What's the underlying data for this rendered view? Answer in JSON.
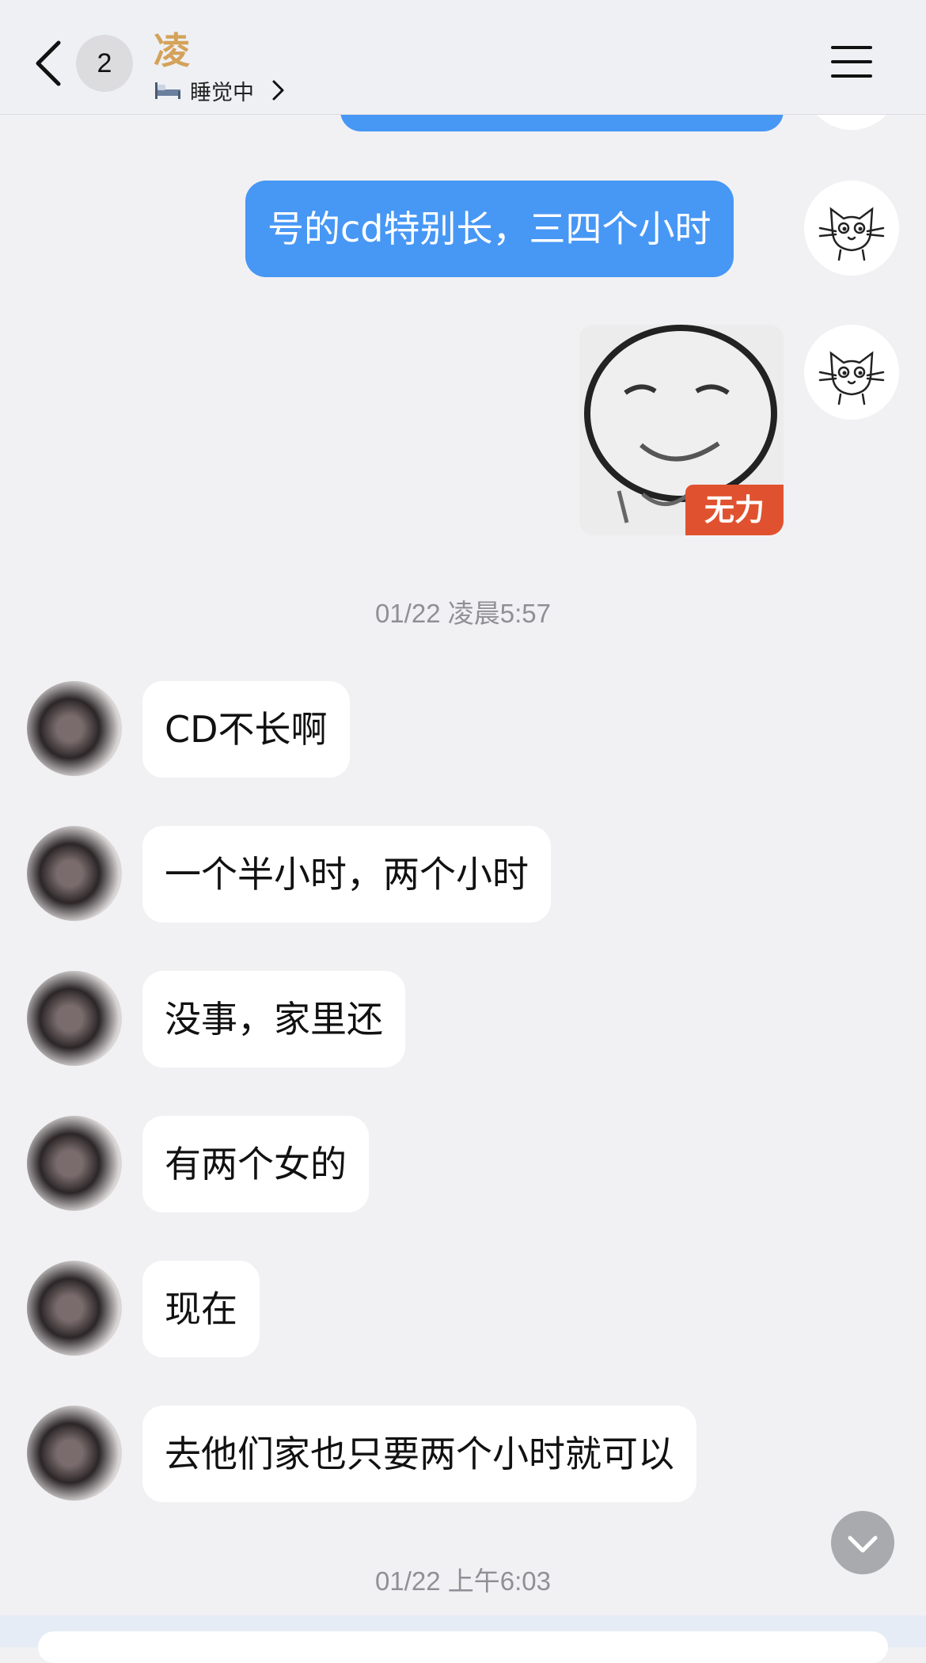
{
  "header": {
    "unread_count": "2",
    "contact_name": "凌",
    "status": "睡觉中"
  },
  "messages": [
    {
      "from": "me",
      "type": "text",
      "text": "号的cd特别长，三四个小时"
    },
    {
      "from": "me",
      "type": "sticker",
      "sticker_label": "无力"
    }
  ],
  "timestamps": [
    "01/22 凌晨5:57",
    "01/22 上午6:03"
  ],
  "incoming": [
    {
      "text": "CD不长啊"
    },
    {
      "text": "一个半小时，两个小时"
    },
    {
      "text": "没事，家里还"
    },
    {
      "text": "有两个女的"
    },
    {
      "text": "现在"
    },
    {
      "text": "去他们家也只要两个小时就可以"
    }
  ],
  "colors": {
    "outgoing_bubble": "#4797f5",
    "incoming_bubble": "#ffffff",
    "contact_name": "#d4a25a",
    "background": "#f1f1f3"
  },
  "icons": [
    "back-arrow-icon",
    "bed-icon",
    "chevron-right-icon",
    "menu-icon",
    "chevron-down-icon"
  ]
}
